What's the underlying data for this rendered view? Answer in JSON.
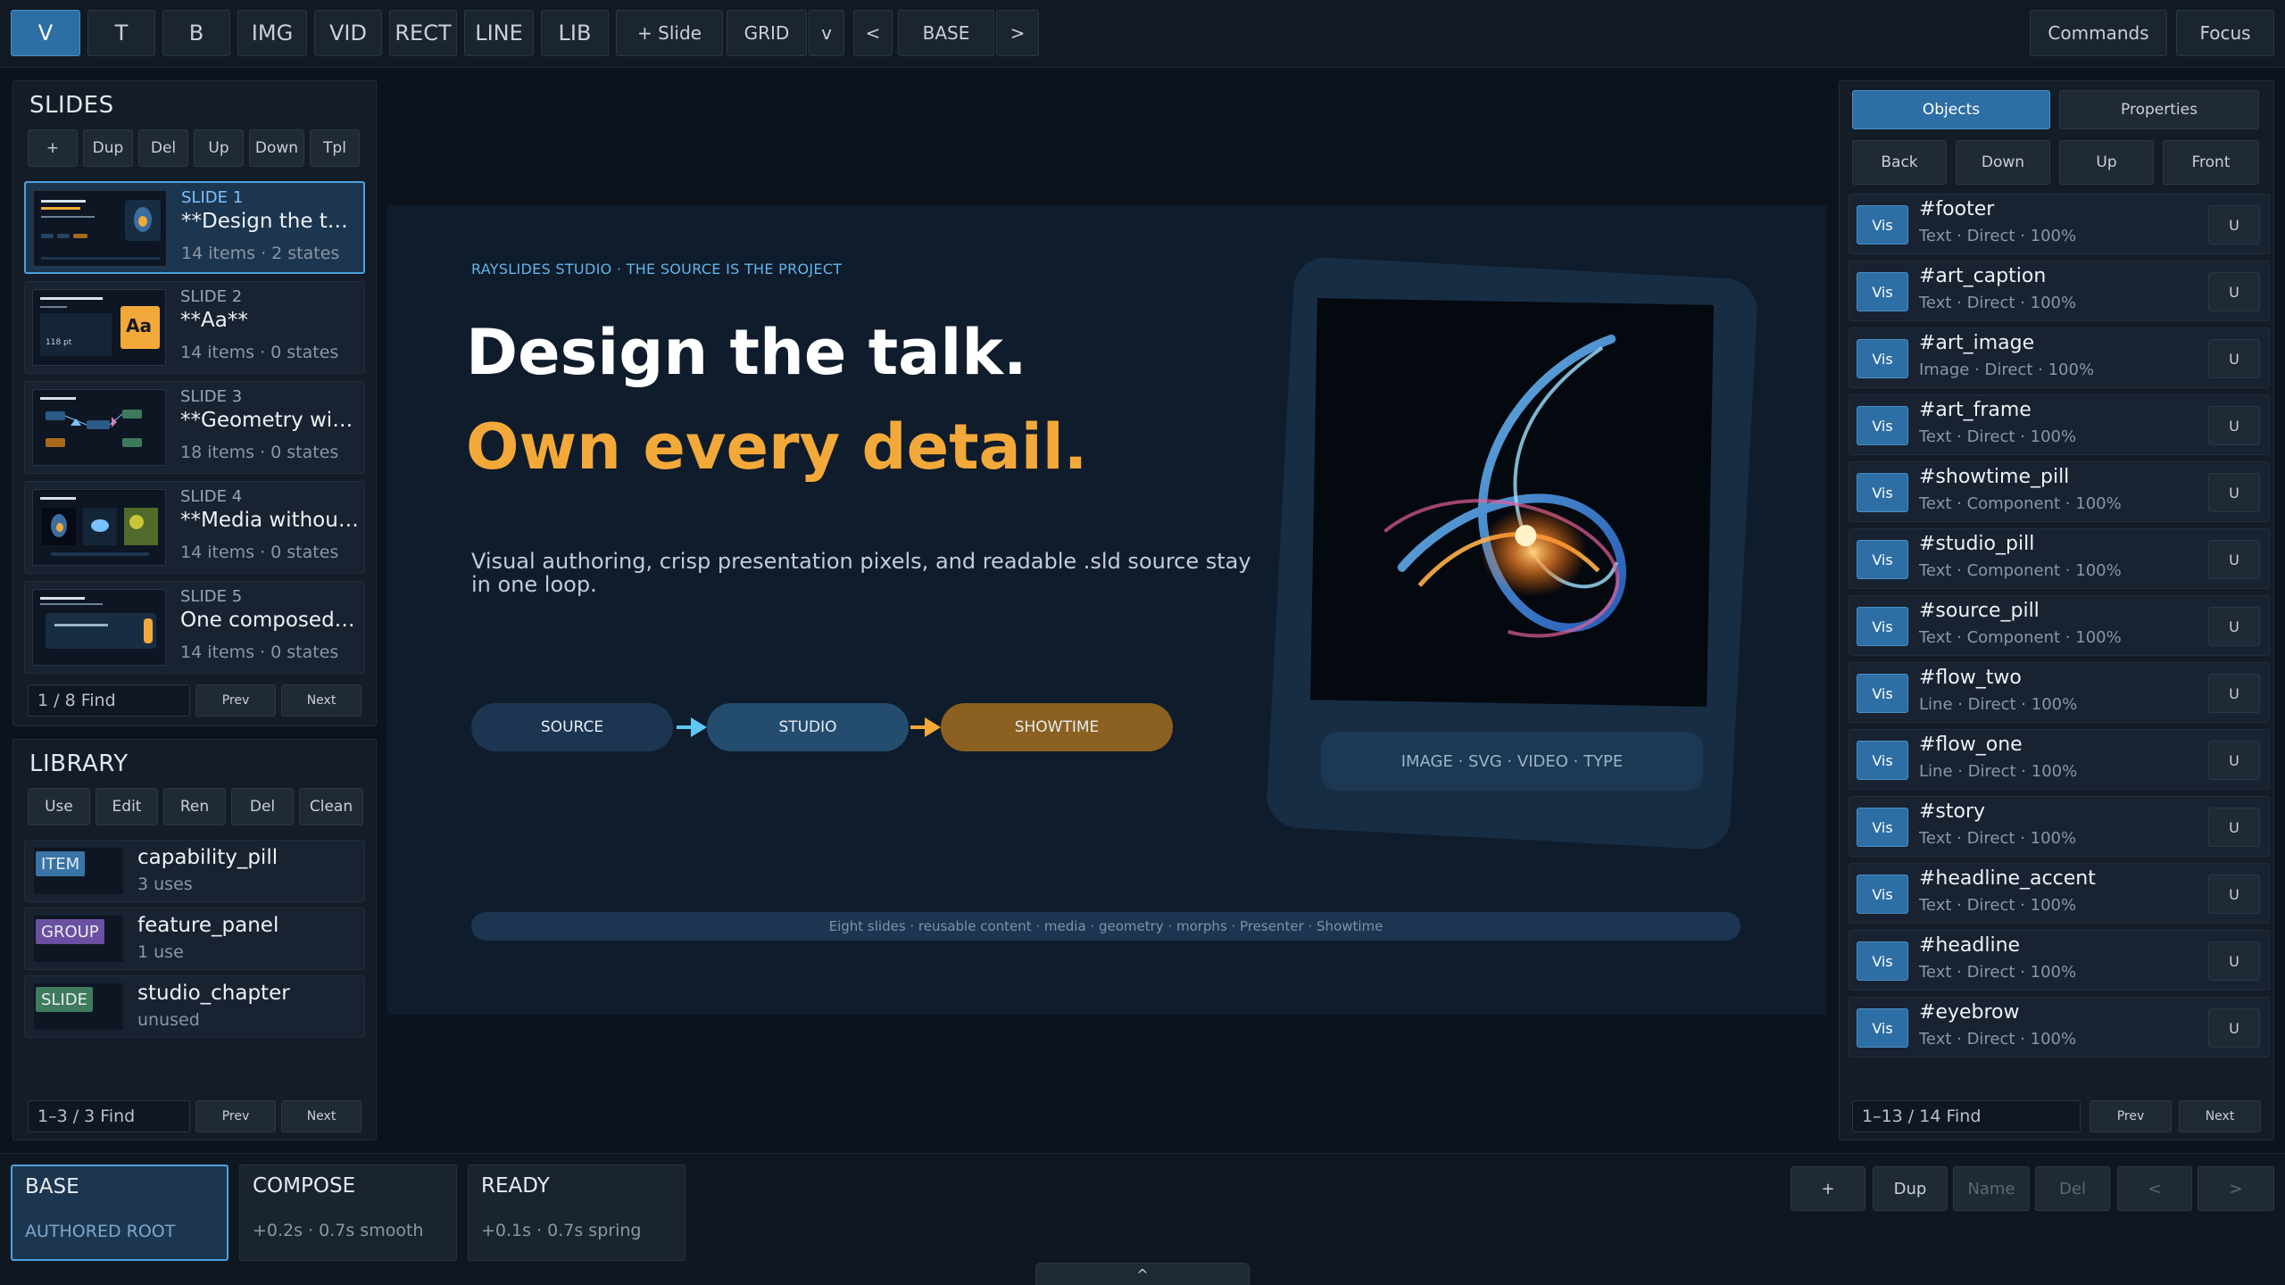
{
  "toolbar": {
    "tools": [
      "V",
      "T",
      "B",
      "IMG",
      "VID",
      "RECT",
      "LINE",
      "LIB"
    ],
    "add_slide": "+ Slide",
    "grid": "GRID",
    "grid_menu": "v",
    "prev_state": "<",
    "state_name": "BASE",
    "next_state": ">",
    "commands": "Commands",
    "focus": "Focus"
  },
  "slides_panel": {
    "title": "SLIDES",
    "buttons": [
      "+",
      "Dup",
      "Del",
      "Up",
      "Down",
      "Tpl"
    ],
    "slides": [
      {
        "num": "SLIDE 1",
        "title": "**Design the talk...",
        "meta": "14 items · 2 states",
        "selected": true
      },
      {
        "num": "SLIDE 2",
        "title": "**Aa**",
        "meta": "14 items · 0 states"
      },
      {
        "num": "SLIDE 3",
        "title": "**Geometry with...",
        "meta": "18 items · 0 states"
      },
      {
        "num": "SLIDE 4",
        "title": "**Media without...",
        "meta": "14 items · 0 states"
      },
      {
        "num": "SLIDE 5",
        "title": "One composed c...",
        "meta": "14 items · 0 states"
      }
    ],
    "thumb2_badge": "Aa",
    "thumb2_size": "118 pt",
    "find": "1 / 8  Find",
    "prev": "Prev",
    "next": "Next"
  },
  "library_panel": {
    "title": "LIBRARY",
    "buttons": [
      "Use",
      "Edit",
      "Ren",
      "Del",
      "Clean"
    ],
    "items": [
      {
        "badge": "ITEM",
        "badge_color": "#3a74a6",
        "name": "capability_pill",
        "uses": "3 uses"
      },
      {
        "badge": "GROUP",
        "badge_color": "#6b4fa0",
        "name": "feature_panel",
        "uses": "1 use"
      },
      {
        "badge": "SLIDE",
        "badge_color": "#3f7a5c",
        "name": "studio_chapter",
        "uses": "unused"
      }
    ],
    "find": "1–3 / 3  Find",
    "prev": "Prev",
    "next": "Next"
  },
  "slide": {
    "eyebrow": "RAYSLIDES STUDIO · THE SOURCE IS THE PROJECT",
    "headline": "Design the talk.",
    "headline_accent": "Own every detail.",
    "story": "Visual authoring, crisp presentation pixels, and readable .sld source stay in one loop.",
    "pills": [
      "SOURCE",
      "STUDIO",
      "SHOWTIME"
    ],
    "art_caption": "IMAGE · SVG · VIDEO · TYPE",
    "footer": "Eight slides · reusable content · media · geometry · morphs · Presenter · Showtime",
    "colors": {
      "accent": "#f3a93a",
      "eyebrow": "#64b4ec",
      "background": "#0f1c2b"
    }
  },
  "objects_panel": {
    "tabs": [
      "Objects",
      "Properties"
    ],
    "order_buttons": [
      "Back",
      "Down",
      "Up",
      "Front"
    ],
    "vis_label": "Vis",
    "unlock_label": "U",
    "objects": [
      {
        "name": "#footer",
        "meta": "Text · Direct · 100%"
      },
      {
        "name": "#art_caption",
        "meta": "Text · Direct · 100%"
      },
      {
        "name": "#art_image",
        "meta": "Image · Direct · 100%"
      },
      {
        "name": "#art_frame",
        "meta": "Text · Direct · 100%"
      },
      {
        "name": "#showtime_pill",
        "meta": "Text · Component · 100%"
      },
      {
        "name": "#studio_pill",
        "meta": "Text · Component · 100%"
      },
      {
        "name": "#source_pill",
        "meta": "Text · Component · 100%"
      },
      {
        "name": "#flow_two",
        "meta": "Line · Direct · 100%"
      },
      {
        "name": "#flow_one",
        "meta": "Line · Direct · 100%"
      },
      {
        "name": "#story",
        "meta": "Text · Direct · 100%"
      },
      {
        "name": "#headline_accent",
        "meta": "Text · Direct · 100%"
      },
      {
        "name": "#headline",
        "meta": "Text · Direct · 100%"
      },
      {
        "name": "#eyebrow",
        "meta": "Text · Direct · 100%"
      }
    ],
    "find": "1–13 / 14  Find",
    "prev": "Prev",
    "next": "Next"
  },
  "states_bar": {
    "states": [
      {
        "name": "BASE",
        "sub": "AUTHORED ROOT",
        "active": true
      },
      {
        "name": "COMPOSE",
        "sub": "+0.2s · 0.7s smooth"
      },
      {
        "name": "READY",
        "sub": "+0.1s · 0.7s spring"
      }
    ],
    "buttons": [
      "+",
      "Dup",
      "Name",
      "Del",
      "<",
      ">"
    ],
    "handle": "^"
  }
}
